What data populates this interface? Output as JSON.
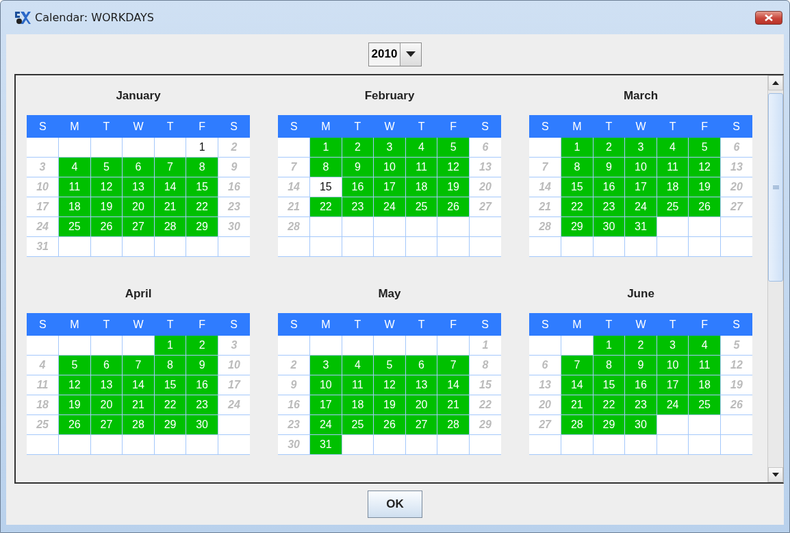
{
  "window": {
    "title": "Calendar:  WORKDAYS"
  },
  "year_selector": {
    "value": "2010"
  },
  "months": [
    {
      "name": "January",
      "weekdays": [
        "S",
        "M",
        "T",
        "W",
        "T",
        "F",
        "S"
      ],
      "weeks": [
        [
          {
            "kind": "blank"
          },
          {
            "kind": "blank"
          },
          {
            "kind": "blank"
          },
          {
            "kind": "blank"
          },
          {
            "kind": "blank"
          },
          {
            "day": "1",
            "kind": "off"
          },
          {
            "day": "2",
            "kind": "weekend"
          }
        ],
        [
          {
            "day": "3",
            "kind": "weekend"
          },
          {
            "day": "4",
            "kind": "work"
          },
          {
            "day": "5",
            "kind": "work"
          },
          {
            "day": "6",
            "kind": "work"
          },
          {
            "day": "7",
            "kind": "work"
          },
          {
            "day": "8",
            "kind": "work"
          },
          {
            "day": "9",
            "kind": "weekend"
          }
        ],
        [
          {
            "day": "10",
            "kind": "weekend"
          },
          {
            "day": "11",
            "kind": "work"
          },
          {
            "day": "12",
            "kind": "work"
          },
          {
            "day": "13",
            "kind": "work"
          },
          {
            "day": "14",
            "kind": "work"
          },
          {
            "day": "15",
            "kind": "work"
          },
          {
            "day": "16",
            "kind": "weekend"
          }
        ],
        [
          {
            "day": "17",
            "kind": "weekend"
          },
          {
            "day": "18",
            "kind": "work"
          },
          {
            "day": "19",
            "kind": "work"
          },
          {
            "day": "20",
            "kind": "work"
          },
          {
            "day": "21",
            "kind": "work"
          },
          {
            "day": "22",
            "kind": "work"
          },
          {
            "day": "23",
            "kind": "weekend"
          }
        ],
        [
          {
            "day": "24",
            "kind": "weekend"
          },
          {
            "day": "25",
            "kind": "work"
          },
          {
            "day": "26",
            "kind": "work"
          },
          {
            "day": "27",
            "kind": "work"
          },
          {
            "day": "28",
            "kind": "work"
          },
          {
            "day": "29",
            "kind": "work"
          },
          {
            "day": "30",
            "kind": "weekend"
          }
        ],
        [
          {
            "day": "31",
            "kind": "weekend"
          },
          {
            "kind": "blank"
          },
          {
            "kind": "blank"
          },
          {
            "kind": "blank"
          },
          {
            "kind": "blank"
          },
          {
            "kind": "blank"
          },
          {
            "kind": "blank"
          }
        ]
      ]
    },
    {
      "name": "February",
      "weekdays": [
        "S",
        "M",
        "T",
        "W",
        "T",
        "F",
        "S"
      ],
      "weeks": [
        [
          {
            "kind": "blank"
          },
          {
            "day": "1",
            "kind": "work"
          },
          {
            "day": "2",
            "kind": "work"
          },
          {
            "day": "3",
            "kind": "work"
          },
          {
            "day": "4",
            "kind": "work"
          },
          {
            "day": "5",
            "kind": "work"
          },
          {
            "day": "6",
            "kind": "weekend"
          }
        ],
        [
          {
            "day": "7",
            "kind": "weekend"
          },
          {
            "day": "8",
            "kind": "work"
          },
          {
            "day": "9",
            "kind": "work"
          },
          {
            "day": "10",
            "kind": "work"
          },
          {
            "day": "11",
            "kind": "work"
          },
          {
            "day": "12",
            "kind": "work"
          },
          {
            "day": "13",
            "kind": "weekend"
          }
        ],
        [
          {
            "day": "14",
            "kind": "weekend"
          },
          {
            "day": "15",
            "kind": "off"
          },
          {
            "day": "16",
            "kind": "work"
          },
          {
            "day": "17",
            "kind": "work"
          },
          {
            "day": "18",
            "kind": "work"
          },
          {
            "day": "19",
            "kind": "work"
          },
          {
            "day": "20",
            "kind": "weekend"
          }
        ],
        [
          {
            "day": "21",
            "kind": "weekend"
          },
          {
            "day": "22",
            "kind": "work"
          },
          {
            "day": "23",
            "kind": "work"
          },
          {
            "day": "24",
            "kind": "work"
          },
          {
            "day": "25",
            "kind": "work"
          },
          {
            "day": "26",
            "kind": "work"
          },
          {
            "day": "27",
            "kind": "weekend"
          }
        ],
        [
          {
            "day": "28",
            "kind": "weekend"
          },
          {
            "kind": "blank"
          },
          {
            "kind": "blank"
          },
          {
            "kind": "blank"
          },
          {
            "kind": "blank"
          },
          {
            "kind": "blank"
          },
          {
            "kind": "blank"
          }
        ],
        [
          {
            "kind": "blank"
          },
          {
            "kind": "blank"
          },
          {
            "kind": "blank"
          },
          {
            "kind": "blank"
          },
          {
            "kind": "blank"
          },
          {
            "kind": "blank"
          },
          {
            "kind": "blank"
          }
        ]
      ]
    },
    {
      "name": "March",
      "weekdays": [
        "S",
        "M",
        "T",
        "W",
        "T",
        "F",
        "S"
      ],
      "weeks": [
        [
          {
            "kind": "blank"
          },
          {
            "day": "1",
            "kind": "work"
          },
          {
            "day": "2",
            "kind": "work"
          },
          {
            "day": "3",
            "kind": "work"
          },
          {
            "day": "4",
            "kind": "work"
          },
          {
            "day": "5",
            "kind": "work"
          },
          {
            "day": "6",
            "kind": "weekend"
          }
        ],
        [
          {
            "day": "7",
            "kind": "weekend"
          },
          {
            "day": "8",
            "kind": "work"
          },
          {
            "day": "9",
            "kind": "work"
          },
          {
            "day": "10",
            "kind": "work"
          },
          {
            "day": "11",
            "kind": "work"
          },
          {
            "day": "12",
            "kind": "work"
          },
          {
            "day": "13",
            "kind": "weekend"
          }
        ],
        [
          {
            "day": "14",
            "kind": "weekend"
          },
          {
            "day": "15",
            "kind": "work"
          },
          {
            "day": "16",
            "kind": "work"
          },
          {
            "day": "17",
            "kind": "work"
          },
          {
            "day": "18",
            "kind": "work"
          },
          {
            "day": "19",
            "kind": "work"
          },
          {
            "day": "20",
            "kind": "weekend"
          }
        ],
        [
          {
            "day": "21",
            "kind": "weekend"
          },
          {
            "day": "22",
            "kind": "work"
          },
          {
            "day": "23",
            "kind": "work"
          },
          {
            "day": "24",
            "kind": "work"
          },
          {
            "day": "25",
            "kind": "work"
          },
          {
            "day": "26",
            "kind": "work"
          },
          {
            "day": "27",
            "kind": "weekend"
          }
        ],
        [
          {
            "day": "28",
            "kind": "weekend"
          },
          {
            "day": "29",
            "kind": "work"
          },
          {
            "day": "30",
            "kind": "work"
          },
          {
            "day": "31",
            "kind": "work"
          },
          {
            "kind": "blank"
          },
          {
            "kind": "blank"
          },
          {
            "kind": "blank"
          }
        ],
        [
          {
            "kind": "blank"
          },
          {
            "kind": "blank"
          },
          {
            "kind": "blank"
          },
          {
            "kind": "blank"
          },
          {
            "kind": "blank"
          },
          {
            "kind": "blank"
          },
          {
            "kind": "blank"
          }
        ]
      ]
    },
    {
      "name": "April",
      "weekdays": [
        "S",
        "M",
        "T",
        "W",
        "T",
        "F",
        "S"
      ],
      "weeks": [
        [
          {
            "kind": "blank"
          },
          {
            "kind": "blank"
          },
          {
            "kind": "blank"
          },
          {
            "kind": "blank"
          },
          {
            "day": "1",
            "kind": "work"
          },
          {
            "day": "2",
            "kind": "work"
          },
          {
            "day": "3",
            "kind": "weekend"
          }
        ],
        [
          {
            "day": "4",
            "kind": "weekend"
          },
          {
            "day": "5",
            "kind": "work"
          },
          {
            "day": "6",
            "kind": "work"
          },
          {
            "day": "7",
            "kind": "work"
          },
          {
            "day": "8",
            "kind": "work"
          },
          {
            "day": "9",
            "kind": "work"
          },
          {
            "day": "10",
            "kind": "weekend"
          }
        ],
        [
          {
            "day": "11",
            "kind": "weekend"
          },
          {
            "day": "12",
            "kind": "work"
          },
          {
            "day": "13",
            "kind": "work"
          },
          {
            "day": "14",
            "kind": "work"
          },
          {
            "day": "15",
            "kind": "work"
          },
          {
            "day": "16",
            "kind": "work"
          },
          {
            "day": "17",
            "kind": "weekend"
          }
        ],
        [
          {
            "day": "18",
            "kind": "weekend"
          },
          {
            "day": "19",
            "kind": "work"
          },
          {
            "day": "20",
            "kind": "work"
          },
          {
            "day": "21",
            "kind": "work"
          },
          {
            "day": "22",
            "kind": "work"
          },
          {
            "day": "23",
            "kind": "work"
          },
          {
            "day": "24",
            "kind": "weekend"
          }
        ],
        [
          {
            "day": "25",
            "kind": "weekend"
          },
          {
            "day": "26",
            "kind": "work"
          },
          {
            "day": "27",
            "kind": "work"
          },
          {
            "day": "28",
            "kind": "work"
          },
          {
            "day": "29",
            "kind": "work"
          },
          {
            "day": "30",
            "kind": "work"
          },
          {
            "kind": "blank"
          }
        ],
        [
          {
            "kind": "blank"
          },
          {
            "kind": "blank"
          },
          {
            "kind": "blank"
          },
          {
            "kind": "blank"
          },
          {
            "kind": "blank"
          },
          {
            "kind": "blank"
          },
          {
            "kind": "blank"
          }
        ]
      ]
    },
    {
      "name": "May",
      "weekdays": [
        "S",
        "M",
        "T",
        "W",
        "T",
        "F",
        "S"
      ],
      "weeks": [
        [
          {
            "kind": "blank"
          },
          {
            "kind": "blank"
          },
          {
            "kind": "blank"
          },
          {
            "kind": "blank"
          },
          {
            "kind": "blank"
          },
          {
            "kind": "blank"
          },
          {
            "day": "1",
            "kind": "weekend"
          }
        ],
        [
          {
            "day": "2",
            "kind": "weekend"
          },
          {
            "day": "3",
            "kind": "work"
          },
          {
            "day": "4",
            "kind": "work"
          },
          {
            "day": "5",
            "kind": "work"
          },
          {
            "day": "6",
            "kind": "work"
          },
          {
            "day": "7",
            "kind": "work"
          },
          {
            "day": "8",
            "kind": "weekend"
          }
        ],
        [
          {
            "day": "9",
            "kind": "weekend"
          },
          {
            "day": "10",
            "kind": "work"
          },
          {
            "day": "11",
            "kind": "work"
          },
          {
            "day": "12",
            "kind": "work"
          },
          {
            "day": "13",
            "kind": "work"
          },
          {
            "day": "14",
            "kind": "work"
          },
          {
            "day": "15",
            "kind": "weekend"
          }
        ],
        [
          {
            "day": "16",
            "kind": "weekend"
          },
          {
            "day": "17",
            "kind": "work"
          },
          {
            "day": "18",
            "kind": "work"
          },
          {
            "day": "19",
            "kind": "work"
          },
          {
            "day": "20",
            "kind": "work"
          },
          {
            "day": "21",
            "kind": "work"
          },
          {
            "day": "22",
            "kind": "weekend"
          }
        ],
        [
          {
            "day": "23",
            "kind": "weekend"
          },
          {
            "day": "24",
            "kind": "work"
          },
          {
            "day": "25",
            "kind": "work"
          },
          {
            "day": "26",
            "kind": "work"
          },
          {
            "day": "27",
            "kind": "work"
          },
          {
            "day": "28",
            "kind": "work"
          },
          {
            "day": "29",
            "kind": "weekend"
          }
        ],
        [
          {
            "day": "30",
            "kind": "weekend"
          },
          {
            "day": "31",
            "kind": "work"
          },
          {
            "kind": "blank"
          },
          {
            "kind": "blank"
          },
          {
            "kind": "blank"
          },
          {
            "kind": "blank"
          },
          {
            "kind": "blank"
          }
        ]
      ]
    },
    {
      "name": "June",
      "weekdays": [
        "S",
        "M",
        "T",
        "W",
        "T",
        "F",
        "S"
      ],
      "weeks": [
        [
          {
            "kind": "blank"
          },
          {
            "kind": "blank"
          },
          {
            "day": "1",
            "kind": "work"
          },
          {
            "day": "2",
            "kind": "work"
          },
          {
            "day": "3",
            "kind": "work"
          },
          {
            "day": "4",
            "kind": "work"
          },
          {
            "day": "5",
            "kind": "weekend"
          }
        ],
        [
          {
            "day": "6",
            "kind": "weekend"
          },
          {
            "day": "7",
            "kind": "work"
          },
          {
            "day": "8",
            "kind": "work"
          },
          {
            "day": "9",
            "kind": "work"
          },
          {
            "day": "10",
            "kind": "work"
          },
          {
            "day": "11",
            "kind": "work"
          },
          {
            "day": "12",
            "kind": "weekend"
          }
        ],
        [
          {
            "day": "13",
            "kind": "weekend"
          },
          {
            "day": "14",
            "kind": "work"
          },
          {
            "day": "15",
            "kind": "work"
          },
          {
            "day": "16",
            "kind": "work"
          },
          {
            "day": "17",
            "kind": "work"
          },
          {
            "day": "18",
            "kind": "work"
          },
          {
            "day": "19",
            "kind": "weekend"
          }
        ],
        [
          {
            "day": "20",
            "kind": "weekend"
          },
          {
            "day": "21",
            "kind": "work"
          },
          {
            "day": "22",
            "kind": "work"
          },
          {
            "day": "23",
            "kind": "work"
          },
          {
            "day": "24",
            "kind": "work"
          },
          {
            "day": "25",
            "kind": "work"
          },
          {
            "day": "26",
            "kind": "weekend"
          }
        ],
        [
          {
            "day": "27",
            "kind": "weekend"
          },
          {
            "day": "28",
            "kind": "work"
          },
          {
            "day": "29",
            "kind": "work"
          },
          {
            "day": "30",
            "kind": "work"
          },
          {
            "kind": "blank"
          },
          {
            "kind": "blank"
          },
          {
            "kind": "blank"
          }
        ],
        [
          {
            "kind": "blank"
          },
          {
            "kind": "blank"
          },
          {
            "kind": "blank"
          },
          {
            "kind": "blank"
          },
          {
            "kind": "blank"
          },
          {
            "kind": "blank"
          },
          {
            "kind": "blank"
          }
        ]
      ]
    }
  ],
  "buttons": [
    {
      "label": "OK"
    }
  ]
}
